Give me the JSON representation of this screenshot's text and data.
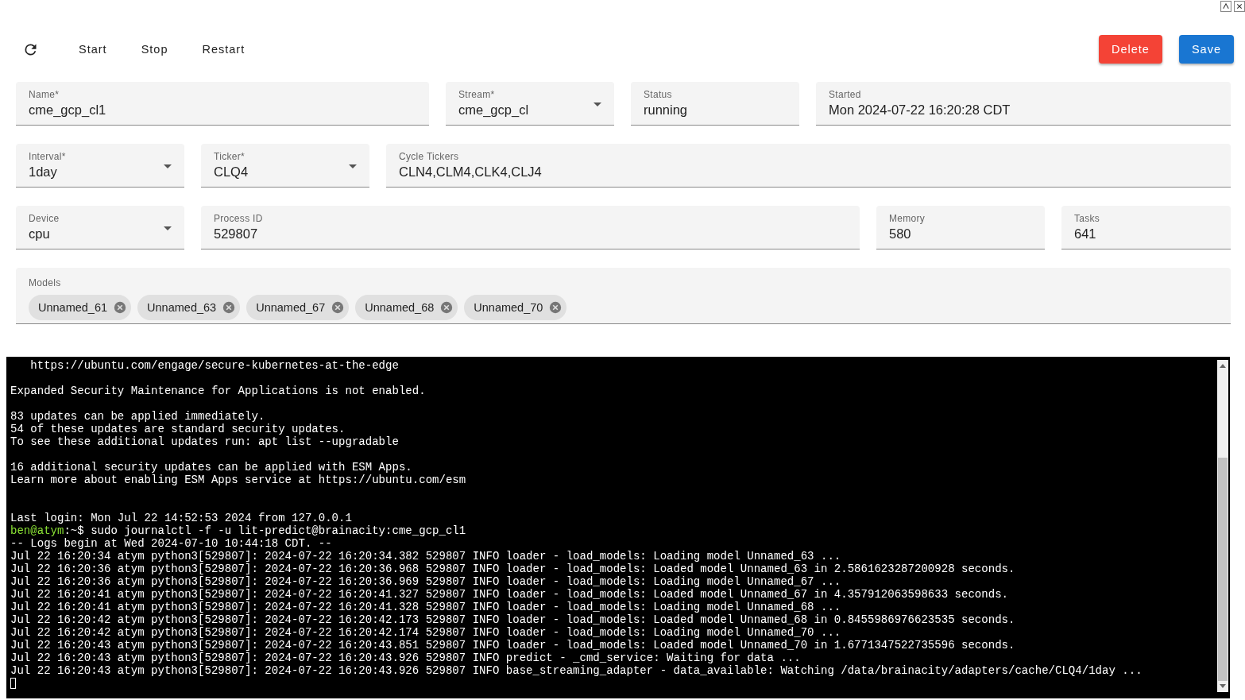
{
  "toolbar": {
    "actions": [
      {
        "label": "Start"
      },
      {
        "label": "Stop"
      },
      {
        "label": "Restart"
      }
    ],
    "buttons": [
      {
        "label": "Delete",
        "kind": "danger"
      },
      {
        "label": "Save",
        "kind": "primary"
      }
    ]
  },
  "field_rows": [
    {
      "fields": [
        {
          "label": "Name*",
          "value": "cme_gcp_cl1",
          "kind": "text"
        },
        {
          "label": "Stream*",
          "value": "cme_gcp_cl",
          "kind": "select"
        },
        {
          "label": "Status",
          "value": "running",
          "kind": "text"
        },
        {
          "label": "Started",
          "value": "Mon 2024-07-22 16:20:28 CDT",
          "kind": "text"
        }
      ]
    },
    {
      "fields": [
        {
          "label": "Interval*",
          "value": "1day",
          "kind": "select"
        },
        {
          "label": "Ticker*",
          "value": "CLQ4",
          "kind": "select"
        },
        {
          "label": "Cycle Tickers",
          "value": "CLN4,CLM4,CLK4,CLJ4",
          "kind": "text"
        }
      ]
    },
    {
      "fields": [
        {
          "label": "Device",
          "value": "cpu",
          "kind": "select"
        },
        {
          "label": "Process ID",
          "value": "529807",
          "kind": "text"
        },
        {
          "label": "Memory",
          "value": "580",
          "kind": "text"
        },
        {
          "label": "Tasks",
          "value": "641",
          "kind": "text"
        }
      ]
    }
  ],
  "models": {
    "label": "Models",
    "chips": [
      {
        "label": "Unnamed_61"
      },
      {
        "label": "Unnamed_63"
      },
      {
        "label": "Unnamed_67"
      },
      {
        "label": "Unnamed_68"
      },
      {
        "label": "Unnamed_70"
      }
    ]
  },
  "terminal": {
    "blocks": [
      {
        "kind": "output",
        "lines": [
          {
            "text": "   https://ubuntu.com/engage/secure-kubernetes-at-the-edge"
          }
        ]
      },
      {
        "kind": "output",
        "lines": [
          {
            "text": "Expanded Security Maintenance for Applications is not enabled."
          }
        ]
      },
      {
        "kind": "output",
        "lines": [
          {
            "text": "83 updates can be applied immediately."
          },
          {
            "text": "54 of these updates are standard security updates."
          },
          {
            "text": "To see these additional updates run: apt list --upgradable"
          }
        ]
      },
      {
        "kind": "output",
        "lines": [
          {
            "text": "16 additional security updates can be applied with ESM Apps."
          },
          {
            "text": "Learn more about enabling ESM Apps service at https://ubuntu.com/esm"
          }
        ]
      },
      {
        "kind": "session",
        "lines": [
          {
            "text": "Last login: Mon Jul 22 14:52:53 2024 from 127.0.0.1"
          },
          {
            "kind": "prompt",
            "user": "ben@atym",
            "text": ":~$ sudo journalctl -f -u lit-predict@brainacity:cme_gcp_cl1"
          },
          {
            "text": "-- Logs begin at Wed 2024-07-10 10:44:18 CDT. --"
          },
          {
            "text": "Jul 22 16:20:34 atym python3[529807]: 2024-07-22 16:20:34.382 529807 INFO loader - load_models: Loading model Unnamed_63 ..."
          },
          {
            "text": "Jul 22 16:20:36 atym python3[529807]: 2024-07-22 16:20:36.968 529807 INFO loader - load_models: Loaded model Unnamed_63 in 2.5861623287200928 seconds."
          },
          {
            "text": "Jul 22 16:20:36 atym python3[529807]: 2024-07-22 16:20:36.969 529807 INFO loader - load_models: Loading model Unnamed_67 ..."
          },
          {
            "text": "Jul 22 16:20:41 atym python3[529807]: 2024-07-22 16:20:41.327 529807 INFO loader - load_models: Loaded model Unnamed_67 in 4.357912063598633 seconds."
          },
          {
            "text": "Jul 22 16:20:41 atym python3[529807]: 2024-07-22 16:20:41.328 529807 INFO loader - load_models: Loading model Unnamed_68 ..."
          },
          {
            "text": "Jul 22 16:20:42 atym python3[529807]: 2024-07-22 16:20:42.173 529807 INFO loader - load_models: Loaded model Unnamed_68 in 0.8455986976623535 seconds."
          },
          {
            "text": "Jul 22 16:20:42 atym python3[529807]: 2024-07-22 16:20:42.174 529807 INFO loader - load_models: Loading model Unnamed_70 ..."
          },
          {
            "text": "Jul 22 16:20:43 atym python3[529807]: 2024-07-22 16:20:43.851 529807 INFO loader - load_models: Loaded model Unnamed_70 in 1.6771347522735596 seconds."
          },
          {
            "text": "Jul 22 16:20:43 atym python3[529807]: 2024-07-22 16:20:43.926 529807 INFO predict - _cmd_service: Waiting for data ..."
          },
          {
            "text": "Jul 22 16:20:43 atym python3[529807]: 2024-07-22 16:20:43.926 529807 INFO base_streaming_adapter - data_available: Watching /data/brainacity/adapters/cache/CLQ4/1day ..."
          }
        ]
      }
    ]
  }
}
